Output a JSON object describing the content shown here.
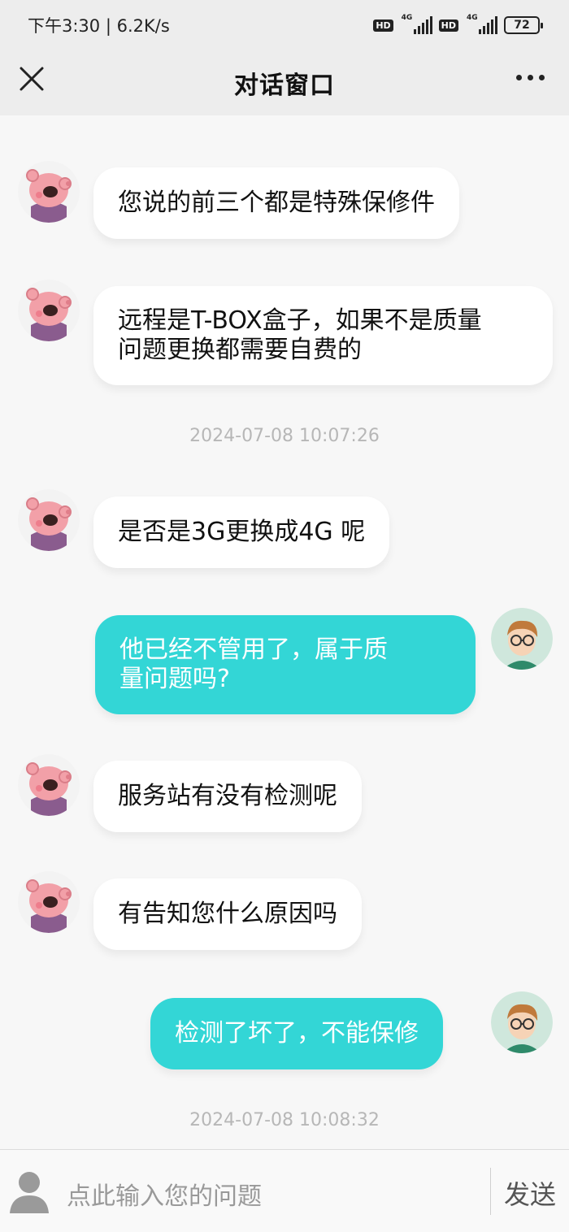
{
  "status_bar": {
    "time_speed": "下午3:30 | 6.2K/s",
    "hd_label": "HD",
    "net_label": "4G",
    "battery": "72"
  },
  "header": {
    "title": "对话窗口"
  },
  "messages": [
    {
      "side": "left",
      "text": "您说的前三个都是特殊保修件"
    },
    {
      "side": "left",
      "text": "远程是T-BOX盒子，如果不是质量\n问题更换都需要自费的"
    },
    {
      "side": "left",
      "text": "是否是3G更换成4G 呢"
    },
    {
      "side": "right",
      "text": "他已经不管用了，属于质\n量问题吗?"
    },
    {
      "side": "left",
      "text": "服务站有没有检测呢"
    },
    {
      "side": "left",
      "text": "有告知您什么原因吗"
    },
    {
      "side": "right",
      "text": "检测了坏了，不能保修"
    }
  ],
  "timestamps": [
    "2024-07-08 10:07:26",
    "2024-07-08 10:08:32"
  ],
  "input": {
    "placeholder": "点此输入您的问题",
    "send_label": "发送"
  },
  "colors": {
    "agent_bubble": "#ffffff",
    "user_bubble": "#33d6d6",
    "header_bg": "#ededed"
  }
}
